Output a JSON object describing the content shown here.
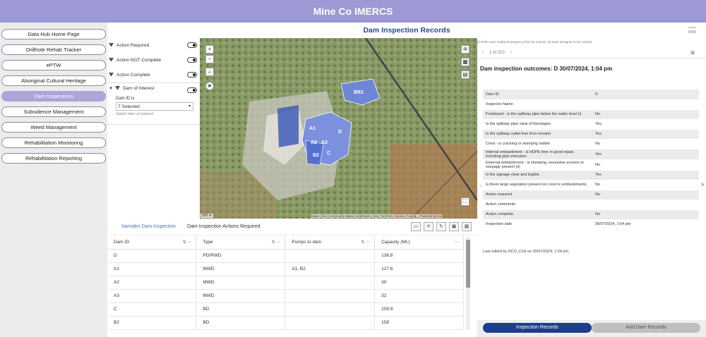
{
  "app": {
    "title": "Mine Co IMERCS"
  },
  "page": {
    "title": "Dam Inspection Records"
  },
  "nav": [
    {
      "label": "Data Hub Home Page",
      "active": false
    },
    {
      "label": "Drillhole Rehab Tracker",
      "active": false
    },
    {
      "label": "ePTW",
      "active": false
    },
    {
      "label": "Aboriginal Cultural Heritage",
      "active": false
    },
    {
      "label": "Dam Inspections",
      "active": true
    },
    {
      "label": "Subsidence Management",
      "active": false
    },
    {
      "label": "Weed Management",
      "active": false
    },
    {
      "label": "Rehabilitation Monitoring",
      "active": false
    },
    {
      "label": "Rehabilitation Reporting",
      "active": false
    }
  ],
  "filters": {
    "items": [
      "Action Required",
      "Action NOT Complete",
      "Action Complete"
    ],
    "interest": {
      "label": "Dam of Interest",
      "field_label": "Dam ID is",
      "selected": "7 Selected",
      "hint": "Select dam of interest"
    }
  },
  "map": {
    "scale": "500 m",
    "attribution": "Maxar | Esri Community Maps Contributors, Esri, TomTom, Garmin, Foursq... Powered by Esri",
    "labels": [
      "BR1",
      "A2",
      "A3",
      "B2",
      "C",
      "D",
      "A1"
    ]
  },
  "table": {
    "tabs": [
      "Namabri Dam Inspection",
      "Dam Inspection Actions Required"
    ],
    "columns": [
      "Dam ID",
      "Type",
      "Pumps to dam",
      "Capacity (ML)"
    ],
    "rows": [
      [
        "D",
        "PD/RWD",
        "",
        "136.8"
      ],
      [
        "A1",
        "MWD",
        "A1, B2",
        "127.6"
      ],
      [
        "A2",
        "MWD",
        "",
        "30"
      ],
      [
        "A3",
        "MWD",
        "",
        "32"
      ],
      [
        "C",
        "BD",
        "",
        "208.9"
      ],
      [
        "B2",
        "BD",
        "",
        "158"
      ]
    ]
  },
  "record": {
    "note": "(i) Refer Dam Safety Emergency Plan for actions. (ii) Dam Designer to be notified.",
    "pager": {
      "prev": "‹",
      "count": "1 of 310",
      "next": "›"
    },
    "title": "Dam inspection outcomes: D 30/07/2024, 1:04 pm",
    "fields": [
      [
        "Dam ID",
        "D"
      ],
      [
        "Inspector Name",
        ""
      ],
      [
        "Freeboard - is the spillway pipe below the water level (i)",
        "No"
      ],
      [
        "Is the spillway pipe clear of blockages",
        "Yes"
      ],
      [
        "Is the spillway outlet free from erosion",
        "Yes"
      ],
      [
        "Crest - is cracking or slumping visible",
        "No"
      ],
      [
        "Internal embankment - is HDPE liner in good repair, including pipe extrusion",
        "Yes"
      ],
      [
        "External embankment - is slumping, excessive erosion or seepage present (ii)",
        "No"
      ],
      [
        "Is the signage clear and legible",
        "Yes"
      ],
      [
        "Is there large vegetation present on crest or embankments",
        "No"
      ],
      [
        "Action required",
        "No"
      ],
      [
        "Action comments",
        ""
      ],
      [
        "Action complete",
        "No"
      ],
      [
        "Inspection date",
        "30/07/2024, 1:04 pm"
      ]
    ],
    "edited": "Last edited by NCO_Civil on 30/07/2024, 1:04 pm."
  },
  "buttons": {
    "inspection_records": "Inspection Records",
    "add_dam_records": "Add Dam Records"
  },
  "colors": {
    "brand": "#9e98d4",
    "primary_button": "#1d3e8f",
    "title_blue": "#2b4c8c"
  }
}
